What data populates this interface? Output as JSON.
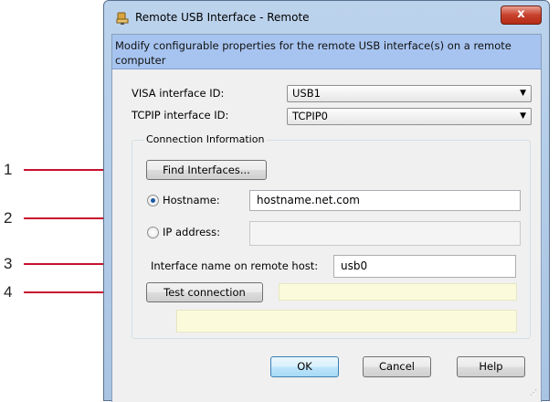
{
  "callouts": [
    "1",
    "2",
    "3",
    "4"
  ],
  "accent_color": "#c8102e",
  "window": {
    "title": "Remote USB Interface - Remote",
    "icon": "usb-device-icon",
    "close_glyph": "x"
  },
  "banner_text": "Modify configurable properties for the remote USB interface(s) on a remote computer",
  "visa": {
    "label": "VISA interface ID:",
    "value": "USB1"
  },
  "tcpip": {
    "label": "TCPIP interface ID:",
    "value": "TCPIP0"
  },
  "connection": {
    "group_title": "Connection Information",
    "find_button": "Find Interfaces...",
    "hostname_label": "Hostname:",
    "hostname_value": "hostname.net.com",
    "ip_label": "IP address:",
    "ip_value": "",
    "interface_name_label": "Interface name on remote host:",
    "interface_name_value": "usb0",
    "test_button": "Test connection",
    "selected_option": "Hostname"
  },
  "buttons": {
    "ok": "OK",
    "cancel": "Cancel",
    "help": "Help"
  }
}
